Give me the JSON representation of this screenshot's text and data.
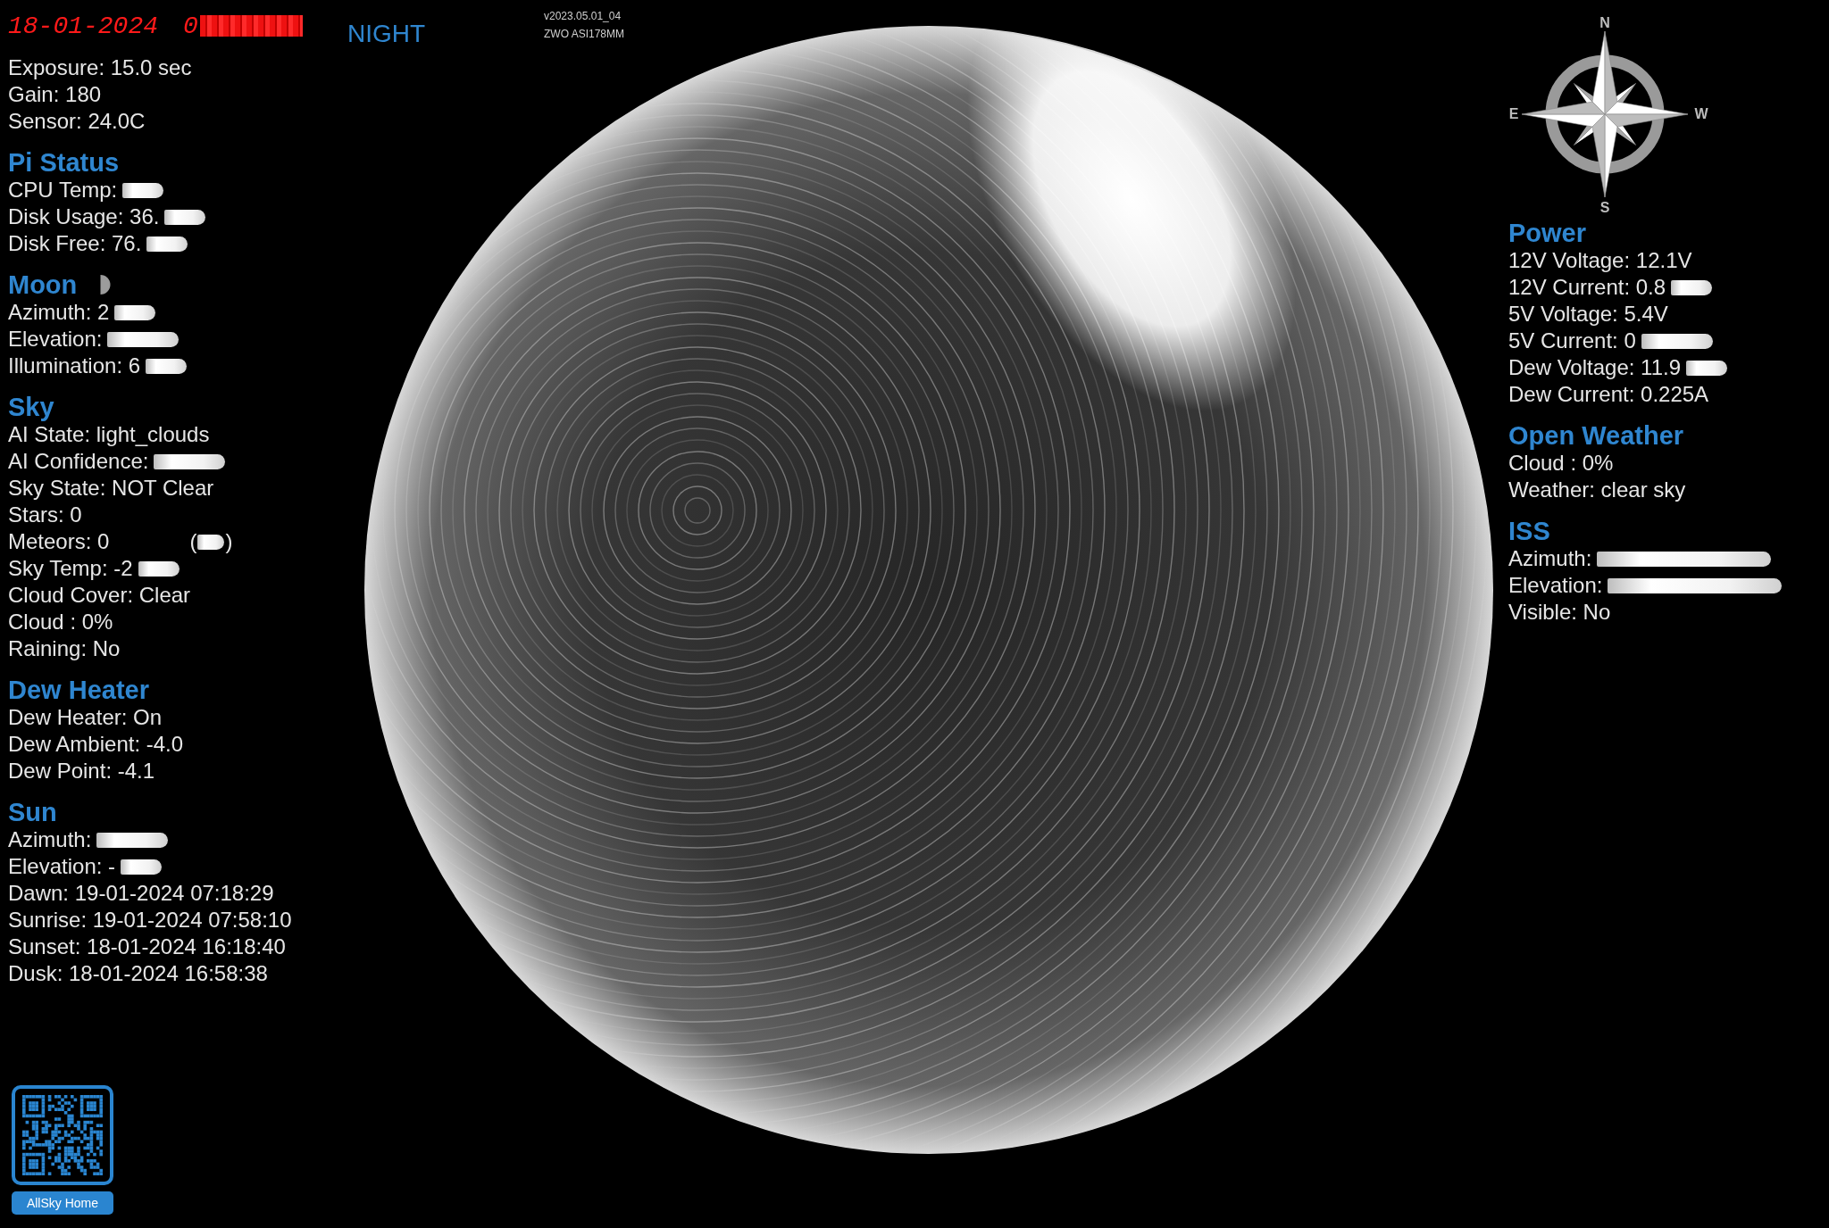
{
  "header": {
    "date": "18-01-2024",
    "time": "0",
    "time_obscured": true,
    "mode": "NIGHT",
    "version": "v2023.05.01_04",
    "camera": "ZWO ASI178MM"
  },
  "camera_info": [
    "Exposure: 15.0 sec",
    "Gain: 180",
    "Sensor: 24.0C"
  ],
  "left_sections": [
    {
      "title": "Pi Status",
      "moon_icon": false,
      "lines": [
        {
          "kind": "smudge",
          "text": "CPU Temp:"
        },
        {
          "kind": "smudge",
          "text": "Disk Usage: 36."
        },
        {
          "kind": "smudge",
          "text": "Disk Free: 76."
        }
      ]
    },
    {
      "title": "Moon",
      "moon_icon": true,
      "lines": [
        {
          "kind": "smudge",
          "text": "Azimuth: 2"
        },
        {
          "kind": "wide",
          "text": "Elevation:"
        },
        {
          "kind": "smudge",
          "text": "Illumination: 6"
        }
      ]
    },
    {
      "title": "Sky",
      "moon_icon": false,
      "lines": [
        {
          "kind": "plain",
          "text": "AI State: light_clouds"
        },
        {
          "kind": "wide",
          "text": "AI Confidence:"
        },
        {
          "kind": "plain",
          "text": "Sky State: NOT Clear"
        },
        {
          "kind": "plain",
          "text": "Stars: 0"
        },
        {
          "kind": "bracketed",
          "text": "Meteors: 0",
          "note": {
            "open": "(",
            "close": ")"
          }
        },
        {
          "kind": "smudge",
          "text": "Sky Temp: -2"
        },
        {
          "kind": "plain",
          "text": "Cloud Cover: Clear"
        },
        {
          "kind": "plain",
          "text": "Cloud : 0%"
        },
        {
          "kind": "plain",
          "text": "Raining: No"
        }
      ]
    },
    {
      "title": "Dew Heater",
      "moon_icon": false,
      "lines": [
        {
          "kind": "plain",
          "text": "Dew Heater: On"
        },
        {
          "kind": "plain",
          "text": "Dew Ambient: -4.0"
        },
        {
          "kind": "plain",
          "text": "Dew Point: -4.1"
        }
      ]
    },
    {
      "title": "Sun",
      "moon_icon": false,
      "lines": [
        {
          "kind": "wide",
          "text": "Azimuth:"
        },
        {
          "kind": "smudge",
          "text": "Elevation: -"
        },
        {
          "kind": "plain",
          "text": "Dawn: 19-01-2024 07:18:29"
        },
        {
          "kind": "plain",
          "text": "Sunrise: 19-01-2024 07:58:10"
        },
        {
          "kind": "plain",
          "text": "Sunset: 18-01-2024 16:18:40"
        },
        {
          "kind": "plain",
          "text": "Dusk: 18-01-2024 16:58:38"
        }
      ]
    }
  ],
  "qr": {
    "label": "AllSky Home"
  },
  "compass": {
    "north": "N",
    "east": "E",
    "west": "W",
    "south": "S"
  },
  "right_sections": [
    {
      "title": "Power",
      "moon_icon": false,
      "lines": [
        {
          "kind": "plain",
          "text": "12V Voltage: 12.1V"
        },
        {
          "kind": "smudge",
          "text": "12V Current: 0.8"
        },
        {
          "kind": "plain",
          "text": "5V Voltage: 5.4V"
        },
        {
          "kind": "wide",
          "text": "5V Current: 0"
        },
        {
          "kind": "smudge",
          "text": "Dew Voltage: 11.9"
        },
        {
          "kind": "plain",
          "text": "Dew Current: 0.225A"
        }
      ]
    },
    {
      "title": "Open Weather",
      "moon_icon": false,
      "lines": [
        {
          "kind": "plain",
          "text": "Cloud : 0%"
        },
        {
          "kind": "plain",
          "text": "Weather: clear sky"
        }
      ]
    },
    {
      "title": "ISS",
      "moon_icon": false,
      "lines": [
        {
          "kind": "long",
          "text": "Azimuth:"
        },
        {
          "kind": "long",
          "text": "Elevation:"
        },
        {
          "kind": "plain",
          "text": "Visible: No"
        }
      ]
    }
  ]
}
